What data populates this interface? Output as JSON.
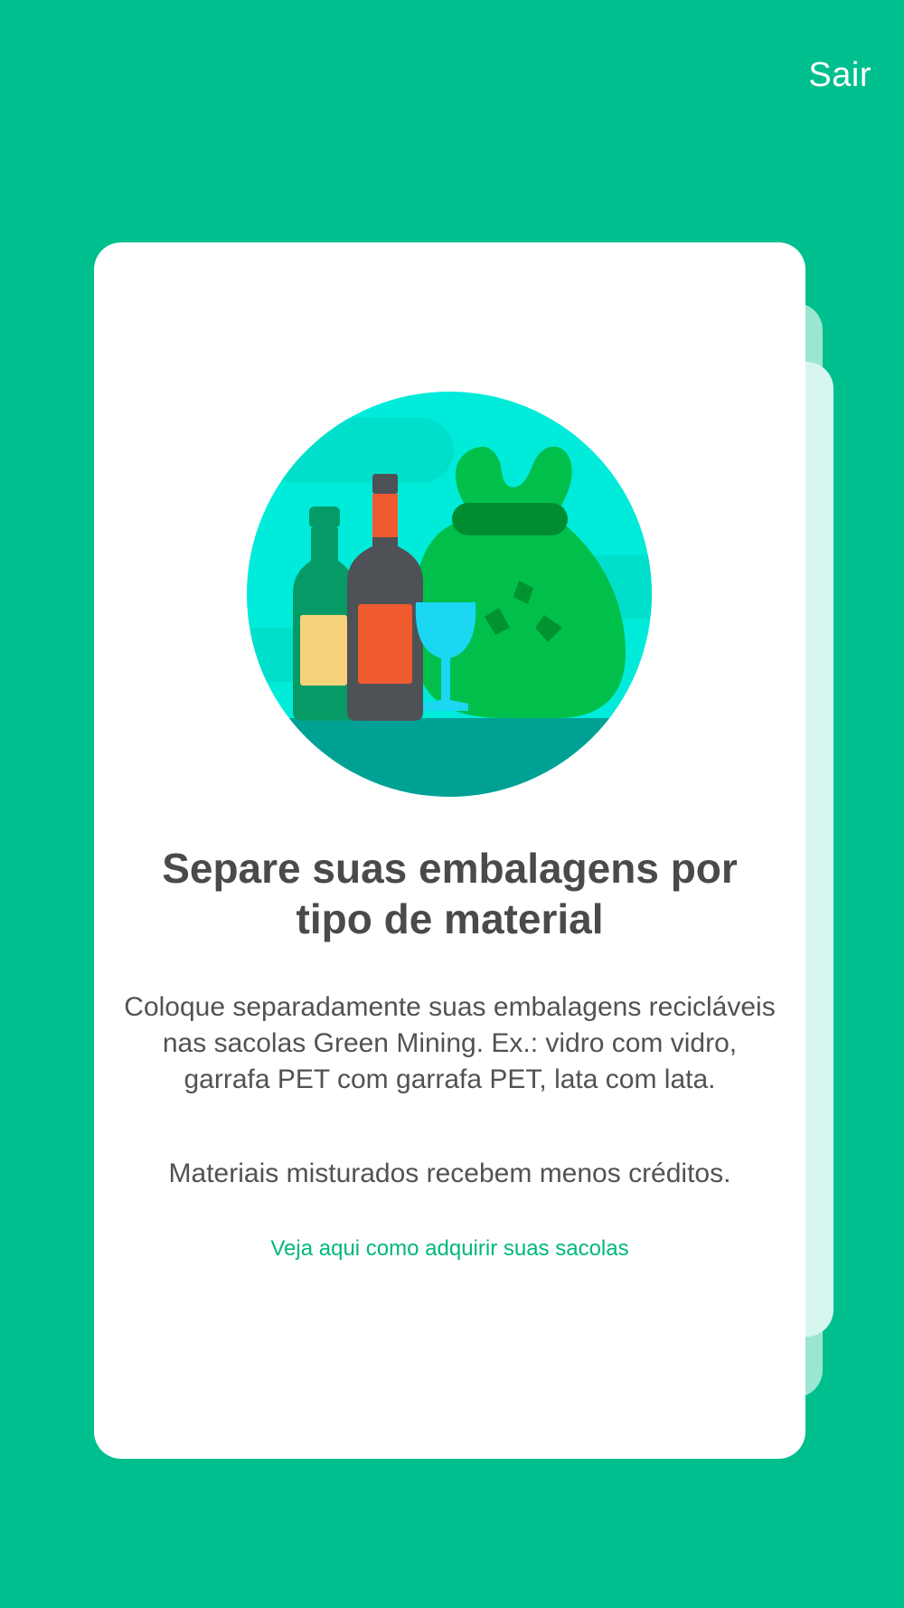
{
  "header": {
    "exit_label": "Sair"
  },
  "card": {
    "illustration_icon": "recycling-bottles-bag-icon",
    "title": "Separe suas embalagens por tipo de material",
    "description": "Coloque separadamente suas embalagens recicláveis nas sacolas Green Mining. Ex.: vidro com vidro, garrafa PET com garrafa PET, lata com lata.",
    "note": "Materiais misturados recebem menos créditos.",
    "link_label": "Veja aqui como adquirir suas sacolas"
  },
  "colors": {
    "background": "#00bf8f",
    "card": "#ffffff",
    "link": "#00b879",
    "text": "#4a4a4a"
  }
}
